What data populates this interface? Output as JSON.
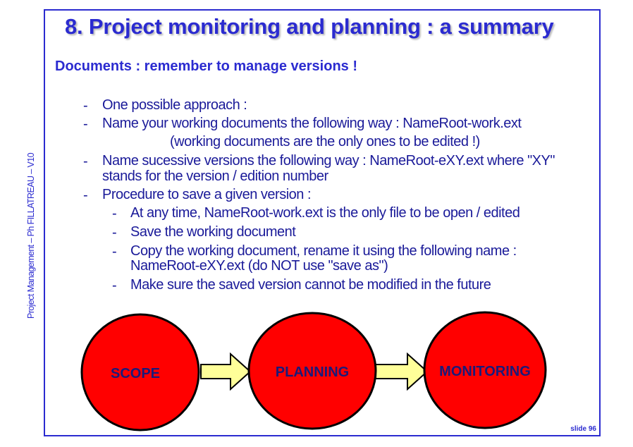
{
  "slide": {
    "title": "8. Project monitoring and planning : a summary",
    "subtitle": "Documents : remember to manage versions !",
    "sidebar_text": "Project Management – Ph FILLATREAU – V10",
    "slide_number": "slide 96"
  },
  "bullets": {
    "dash": "-",
    "b1": "One possible approach :",
    "b2": "Name your working documents the following way : NameRoot-work.ext",
    "b2_note": "(working documents are the only ones to be edited !)",
    "b3_line1": "Name sucessive versions the following way : NameRoot-eXY.ext where \"XY\"",
    "b3_line2": "stands for the version / edition number",
    "b4": "Procedure to save a given version :",
    "s1": "At any time, NameRoot-work.ext is the only file to be open / edited",
    "s2": "Save the working document",
    "s3_line1": "Copy the working document, rename it using the following name :",
    "s3_line2": "NameRoot-eXY.ext (do NOT use \"save as\")",
    "s4": "Make sure the saved version cannot be modified in the future"
  },
  "diagram": {
    "circles": [
      "SCOPE",
      "PLANNING",
      "MONITORING"
    ],
    "circle_color": "#ff0000",
    "arrow_color": "#ffff99"
  }
}
